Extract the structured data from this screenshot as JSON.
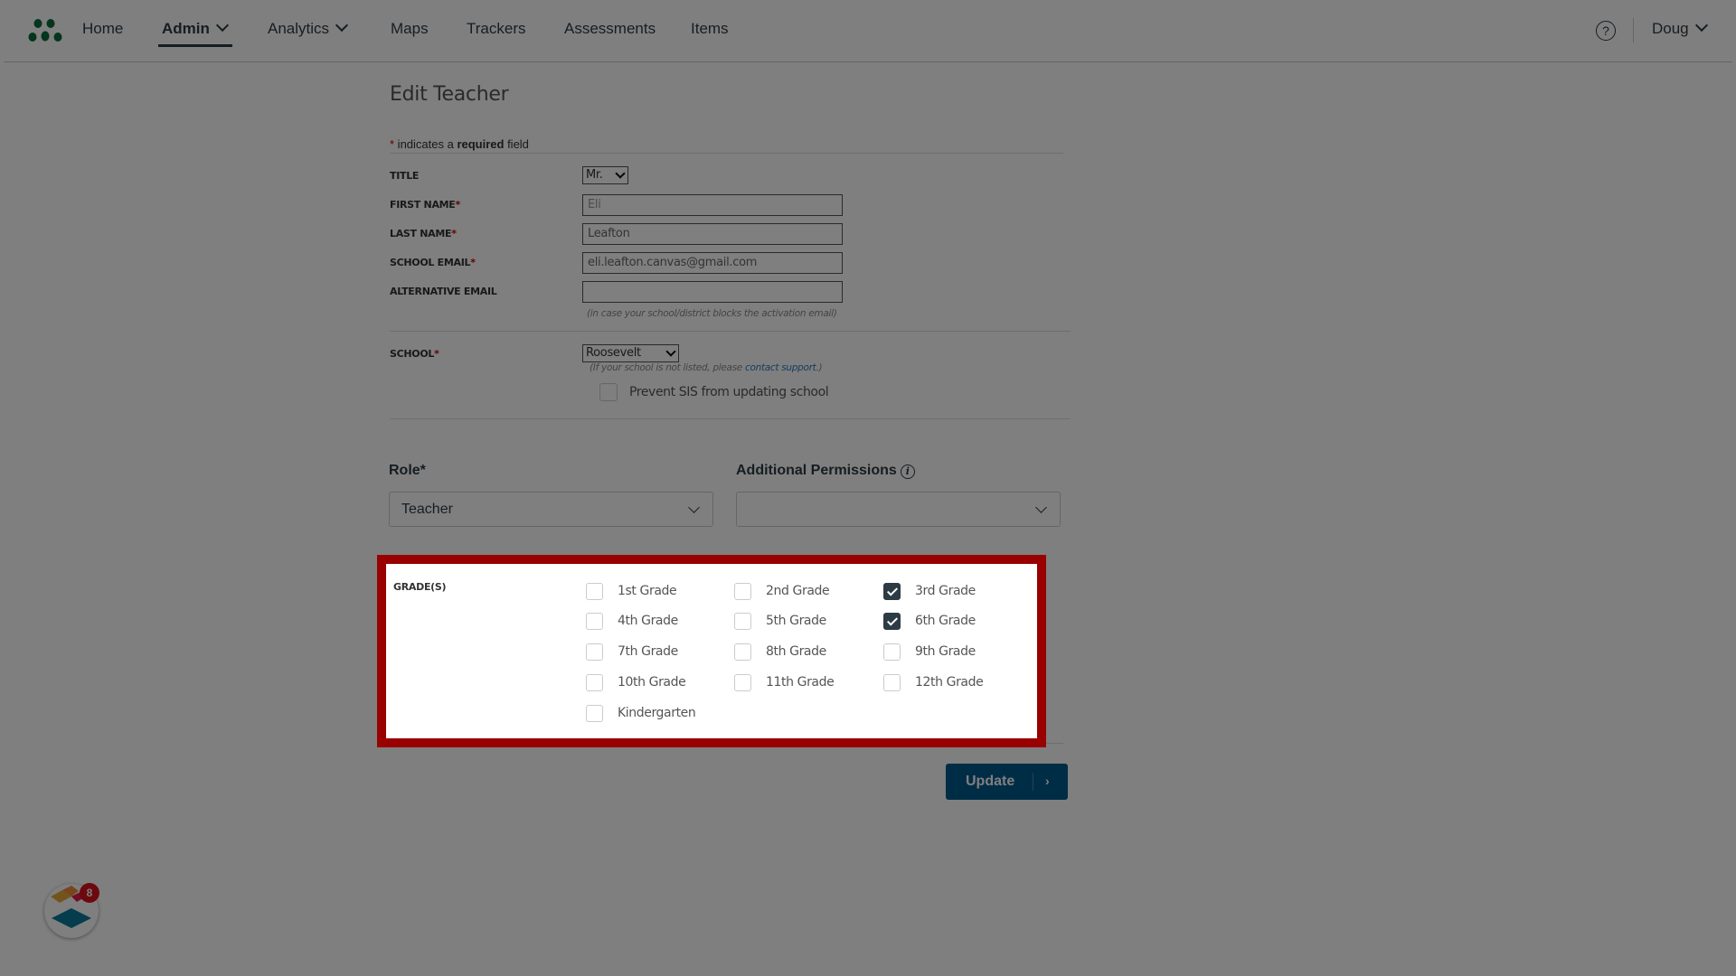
{
  "nav": {
    "items": [
      {
        "label": "Home",
        "has_dropdown": false,
        "active": false
      },
      {
        "label": "Admin",
        "has_dropdown": true,
        "active": true
      },
      {
        "label": "Analytics",
        "has_dropdown": true,
        "active": false
      },
      {
        "label": "Maps",
        "has_dropdown": false,
        "active": false
      },
      {
        "label": "Trackers",
        "has_dropdown": false,
        "active": false
      },
      {
        "label": "Assessments",
        "has_dropdown": false,
        "active": false
      },
      {
        "label": "Items",
        "has_dropdown": false,
        "active": false
      }
    ],
    "help_icon": "?",
    "user_name": "Doug"
  },
  "form": {
    "title": "Edit Teacher",
    "required_note": {
      "star": "*",
      "pre": " indicates a ",
      "bold": "required",
      "post": " field"
    },
    "fields": {
      "title": {
        "label": "TITLE",
        "value": "Mr."
      },
      "first_name": {
        "label": "FIRST NAME",
        "required": "*",
        "value": "Eli"
      },
      "last_name": {
        "label": "LAST NAME",
        "required": "*",
        "value": "Leafton"
      },
      "school_email": {
        "label": "SCHOOL EMAIL",
        "required": "*",
        "value": "eli.leafton.canvas@gmail.com"
      },
      "alt_email": {
        "label": "ALTERNATIVE EMAIL",
        "value": "",
        "hint": "(in case your school/district blocks the activation email)"
      },
      "school": {
        "label": "SCHOOL",
        "required": "*",
        "value": "Roosevelt",
        "hint_pre": "(If your school is not listed, please ",
        "hint_link": "contact support",
        "hint_post": ".)"
      },
      "prevent_sis": {
        "label": "Prevent SIS from updating school",
        "checked": false
      }
    },
    "role": {
      "label": "Role*",
      "value": "Teacher"
    },
    "additional_permissions": {
      "label": "Additional Permissions",
      "info_icon": "i",
      "value": ""
    },
    "grades": {
      "label": "GRADE(S)",
      "options": [
        {
          "label": "1st Grade",
          "checked": false
        },
        {
          "label": "2nd Grade",
          "checked": false
        },
        {
          "label": "3rd Grade",
          "checked": true
        },
        {
          "label": "4th Grade",
          "checked": false
        },
        {
          "label": "5th Grade",
          "checked": false
        },
        {
          "label": "6th Grade",
          "checked": true
        },
        {
          "label": "7th Grade",
          "checked": false
        },
        {
          "label": "8th Grade",
          "checked": false
        },
        {
          "label": "9th Grade",
          "checked": false
        },
        {
          "label": "10th Grade",
          "checked": false
        },
        {
          "label": "11th Grade",
          "checked": false
        },
        {
          "label": "12th Grade",
          "checked": false
        },
        {
          "label": "Kindergarten",
          "checked": false
        }
      ]
    },
    "update_button": {
      "label": "Update",
      "arrow": "›"
    }
  },
  "widget": {
    "badge_count": "8"
  },
  "colors": {
    "brand_green": "#0b6b3a",
    "button_blue": "#005a8c",
    "highlight_red": "#990000",
    "required_red": "#cc0000"
  }
}
